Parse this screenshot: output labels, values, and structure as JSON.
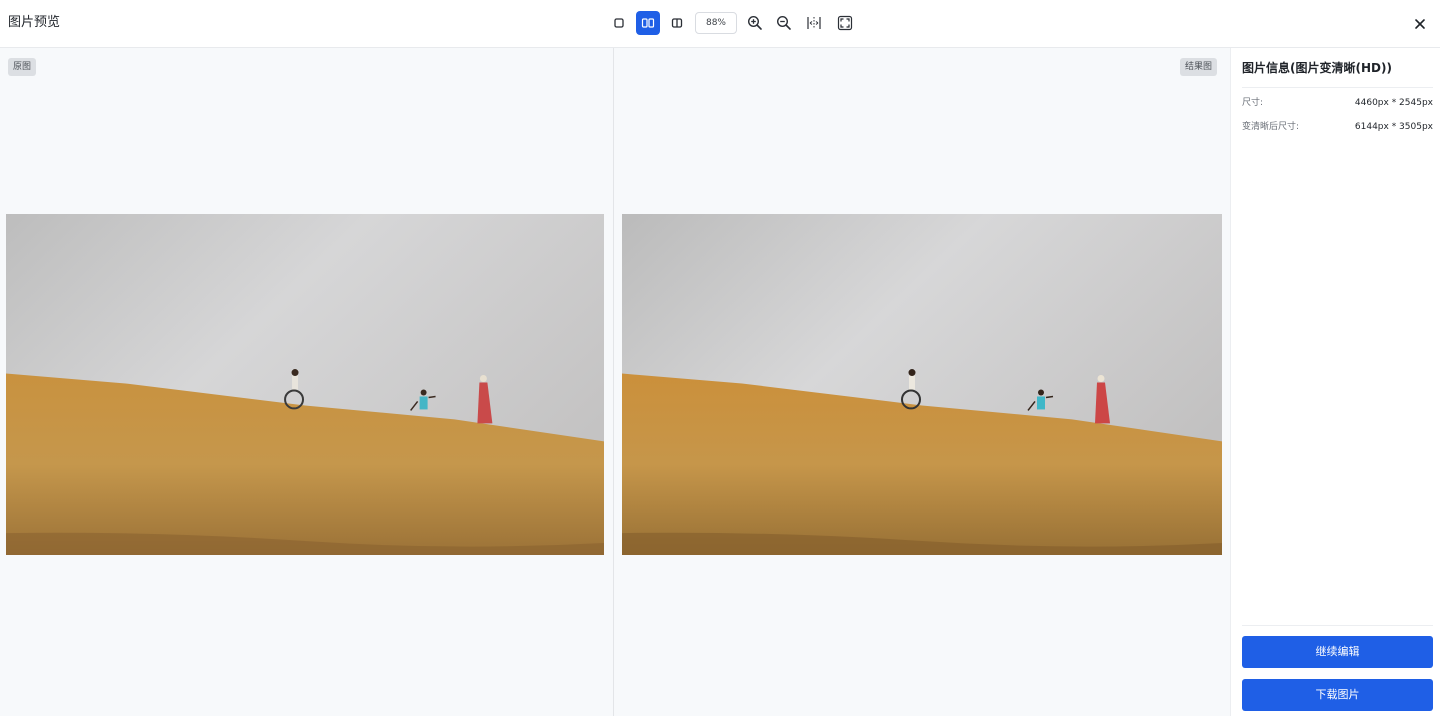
{
  "header": {
    "title": "图片预览",
    "zoom": "88%",
    "tools": [
      {
        "icon": "single-view-icon",
        "active": false
      },
      {
        "icon": "side-by-side-view-icon",
        "active": true
      },
      {
        "icon": "split-compare-view-icon",
        "active": false
      },
      {
        "icon": "zoom-in-icon",
        "active": false
      },
      {
        "icon": "zoom-out-icon",
        "active": false
      },
      {
        "icon": "fit-width-icon",
        "active": false
      },
      {
        "icon": "fullscreen-icon",
        "active": false
      }
    ],
    "close_icon": "close-icon"
  },
  "preview": {
    "original_label": "原图",
    "result_label": "结果图"
  },
  "info": {
    "heading": "图片信息(图片变清晰(HD))",
    "rows": [
      {
        "label": "尺寸:",
        "value": "4460px * 2545px"
      },
      {
        "label": "变清晰后尺寸:",
        "value": "6144px * 3505px"
      }
    ],
    "continue_label": "继续编辑",
    "download_label": "下载图片"
  },
  "colors": {
    "accent": "#1f5fe6",
    "stage_bg": "#f7f9fb",
    "sky": "#cfd0d2",
    "grass": "#c69443"
  }
}
